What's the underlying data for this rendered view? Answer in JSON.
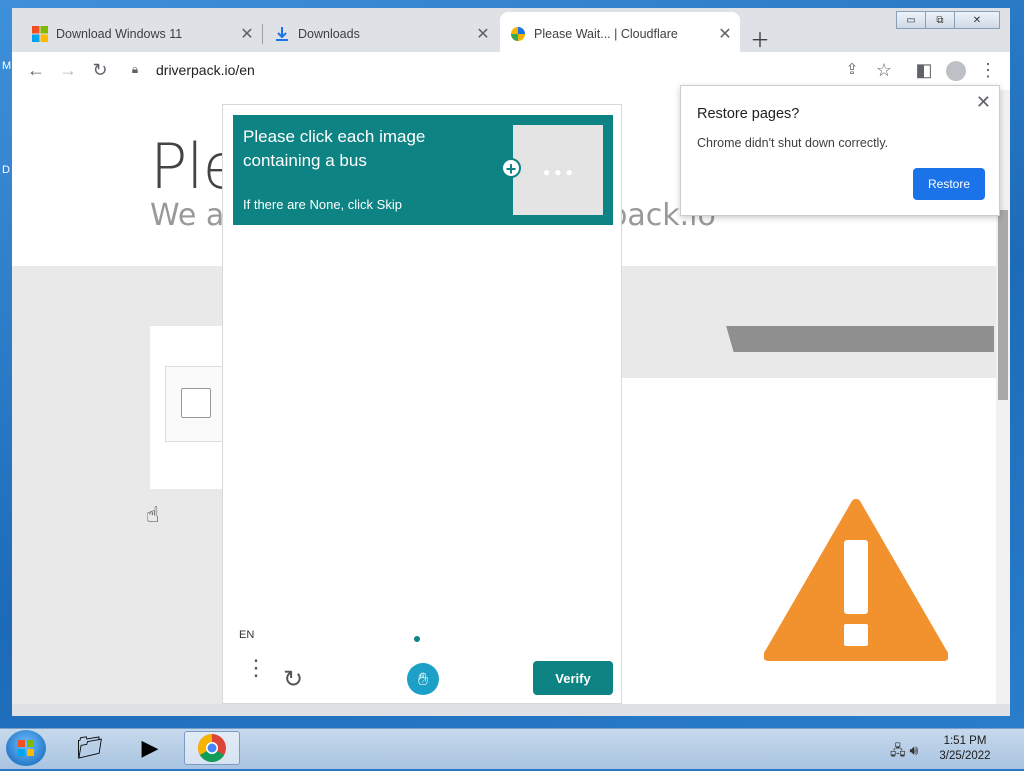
{
  "desktop": {
    "left_glyph_1": "M",
    "left_glyph_2": "D"
  },
  "window": {
    "controls": {
      "minimize": "▭",
      "maximize": "⧉",
      "close": "✕"
    }
  },
  "tabs": [
    {
      "label": "Download Windows 11",
      "icon": "windows-logo-icon"
    },
    {
      "label": "Downloads",
      "icon": "download-icon"
    },
    {
      "label": "Please Wait... | Cloudflare",
      "icon": "cloudflare-icon",
      "active": true
    }
  ],
  "toolbar": {
    "url": "driverpack.io/en"
  },
  "page": {
    "hero_title": "Ple",
    "hero_sub_left": "We ar",
    "hero_sub_right": "rpack.io"
  },
  "captcha": {
    "title": "Please click each image containing a bus",
    "hint": "If there are None, click Skip",
    "language": "EN",
    "verify_label": "Verify",
    "accent_color": "#0e8383"
  },
  "popup": {
    "title": "Restore pages?",
    "message": "Chrome didn't shut down correctly.",
    "button_label": "Restore",
    "button_color": "#1a73e8"
  },
  "taskbar": {
    "time": "1:51 PM",
    "date": "3/25/2022"
  }
}
